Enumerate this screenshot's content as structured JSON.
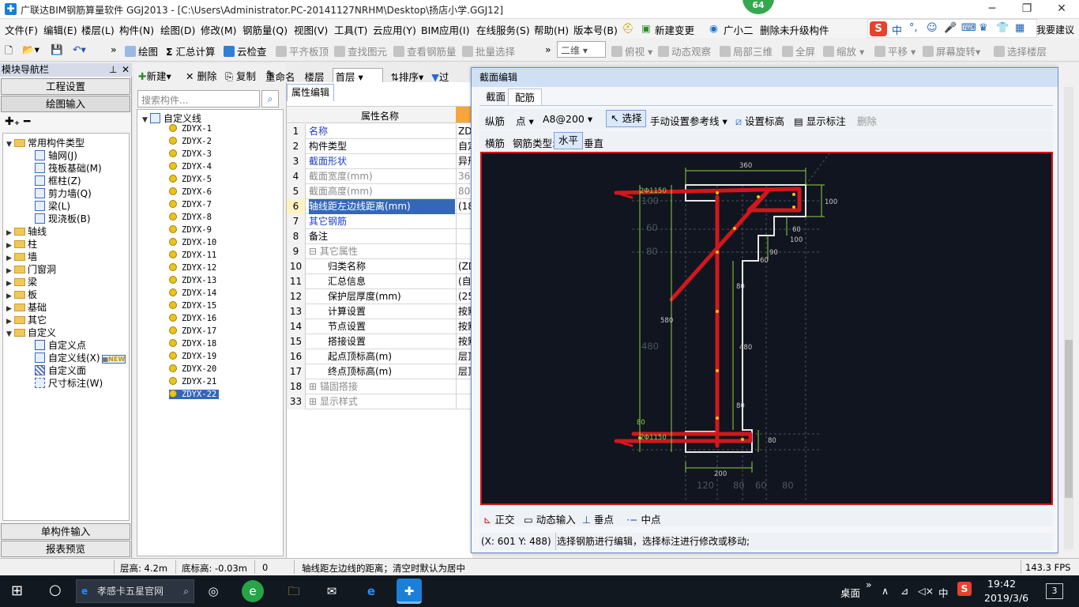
{
  "title_bar": {
    "title": "广联达BIM钢筋算量软件 GGJ2013 - [C:\\Users\\Administrator.PC-20141127NRHM\\Desktop\\扬店小学.GGJ12]",
    "badge": "64"
  },
  "menu": [
    "文件(F)",
    "编辑(E)",
    "楼层(L)",
    "构件(N)",
    "绘图(D)",
    "修改(M)",
    "钢筋量(Q)",
    "视图(V)",
    "工具(T)",
    "云应用(Y)",
    "BIM应用(I)",
    "在线服务(S)",
    "帮助(H)",
    "版本号(B)",
    "新建变更",
    "广小二",
    "删除未升级构件"
  ],
  "ime": {
    "lang": "中",
    "extra": "我要建议"
  },
  "toolbar": {
    "draw": "绘图",
    "sum": "汇总计算",
    "cloud_check": "云检查",
    "flat_top": "平齐板顶",
    "find_elem": "查找图元",
    "view_rebar": "查看钢筋量",
    "batch_select": "批量选择",
    "view_mode": "二维",
    "plan": "俯视",
    "dyn_view": "动态观察",
    "partial_3d": "局部三维",
    "full_screen": "全屏",
    "zoom": "缩放",
    "pan": "平移",
    "rotate": "屏幕旋转",
    "select_floor": "选择楼层"
  },
  "left_nav": {
    "header": "模块导航栏",
    "btn_project": "工程设置",
    "btn_draw": "绘图输入",
    "btn_single": "单构件输入",
    "btn_report": "报表预览",
    "common_types": "常用构件类型",
    "common_items": [
      "轴网(J)",
      "筏板基础(M)",
      "框柱(Z)",
      "剪力墙(Q)",
      "梁(L)",
      "现浇板(B)"
    ],
    "groups": [
      "轴线",
      "柱",
      "墙",
      "门窗洞",
      "梁",
      "板",
      "基础",
      "其它"
    ],
    "custom": "自定义",
    "custom_items": [
      "自定义点",
      "自定义线(X)",
      "自定义面",
      "尺寸标注(W)"
    ],
    "new_tag": "NEW"
  },
  "list_panel": {
    "btn_new": "新建",
    "btn_delete": "删除",
    "btn_copy": "复制",
    "btn_rename": "重命名",
    "floor_label": "楼层",
    "floor_value": "首层",
    "btn_sort": "排序",
    "btn_filter": "过",
    "search_placeholder": "搜索构件...",
    "root": "自定义线",
    "items": [
      "ZDYX-1",
      "ZDYX-2",
      "ZDYX-3",
      "ZDYX-4",
      "ZDYX-5",
      "ZDYX-6",
      "ZDYX-7",
      "ZDYX-8",
      "ZDYX-9",
      "ZDYX-10",
      "ZDYX-11",
      "ZDYX-12",
      "ZDYX-13",
      "ZDYX-14",
      "ZDYX-15",
      "ZDYX-16",
      "ZDYX-17",
      "ZDYX-18",
      "ZDYX-19",
      "ZDYX-20",
      "ZDYX-21",
      "ZDYX-22"
    ],
    "selected": "ZDYX-22"
  },
  "props": {
    "tab": "属性编辑",
    "col_name": "属性名称",
    "rows": [
      {
        "n": "1",
        "name": "名称",
        "val": "ZDY"
      },
      {
        "n": "2",
        "name": "构件类型",
        "val": "自定"
      },
      {
        "n": "3",
        "name": "截面形状",
        "val": "异形"
      },
      {
        "n": "4",
        "name": "截面宽度(mm)",
        "val": "360"
      },
      {
        "n": "5",
        "name": "截面高度(mm)",
        "val": "800"
      },
      {
        "n": "6",
        "name": "轴线距左边线距离(mm)",
        "val": "(18"
      },
      {
        "n": "7",
        "name": "其它钢筋",
        "val": ""
      },
      {
        "n": "8",
        "name": "备注",
        "val": ""
      },
      {
        "n": "9",
        "name": "其它属性",
        "val": ""
      },
      {
        "n": "10",
        "name": "归类名称",
        "val": "(ZD"
      },
      {
        "n": "11",
        "name": "汇总信息",
        "val": "(自"
      },
      {
        "n": "12",
        "name": "保护层厚度(mm)",
        "val": "(25"
      },
      {
        "n": "13",
        "name": "计算设置",
        "val": "按默"
      },
      {
        "n": "14",
        "name": "节点设置",
        "val": "按默"
      },
      {
        "n": "15",
        "name": "搭接设置",
        "val": "按默"
      },
      {
        "n": "16",
        "name": "起点顶标高(m)",
        "val": "层顶"
      },
      {
        "n": "17",
        "name": "终点顶标高(m)",
        "val": "层顶"
      },
      {
        "n": "18",
        "name": "锚固搭接",
        "val": ""
      },
      {
        "n": "33",
        "name": "显示样式",
        "val": ""
      }
    ]
  },
  "dialog": {
    "title": "截面编辑",
    "tab_section": "截面",
    "tab_rebar": "配筋",
    "row1": {
      "zong": "纵筋",
      "point": "点",
      "spec": "A8@200",
      "select": "选择",
      "ref_line": "手动设置参考线",
      "set_elev": "设置标高",
      "show_dim": "显示标注",
      "delete": "删除"
    },
    "row2": {
      "heng": "横筋",
      "type_label": "钢筋类型:",
      "horizontal": "水平",
      "vertical": "垂直"
    },
    "dims": {
      "d360": "360",
      "d100a": "100",
      "d100b": "100",
      "d60a": "60",
      "d60b": "60",
      "d60c": "60",
      "d90a": "90",
      "d80a": "80",
      "d80b": "80",
      "d480a": "480",
      "d480b": "480",
      "d580": "580",
      "d200": "200",
      "d120": "120",
      "d80c": "80",
      "d60d": "60",
      "d100c": "100",
      "d80d": "80",
      "d80e": "80",
      "d80f": "80",
      "lbl1": "2Φ1150",
      "lbl2": "2Φ1150",
      "d80g": "80"
    },
    "bottom": {
      "ortho": "正交",
      "dyn_input": "动态输入",
      "perp": "垂点",
      "mid": "中点"
    },
    "coords": "(X: 601 Y: 488)",
    "hint": "选择钢筋进行编辑，选择标注进行修改或移动;"
  },
  "status": {
    "floor_height": "层高: 4.2m",
    "bottom_elev": "底标高: -0.03m",
    "zero": "0",
    "desc": "轴线距左边线的距离；清空时默认为居中",
    "fps": "143.3 FPS"
  },
  "taskbar": {
    "search": "孝感卡五星官网",
    "desktop": "桌面",
    "ime": "中",
    "time": "19:42",
    "date": "2019/3/6",
    "notif": "3"
  },
  "colors": {
    "accent": "#3467b8",
    "rebar": "#d3161d",
    "canvas_bg": "#11151f",
    "dimension": "#8ad14a"
  }
}
